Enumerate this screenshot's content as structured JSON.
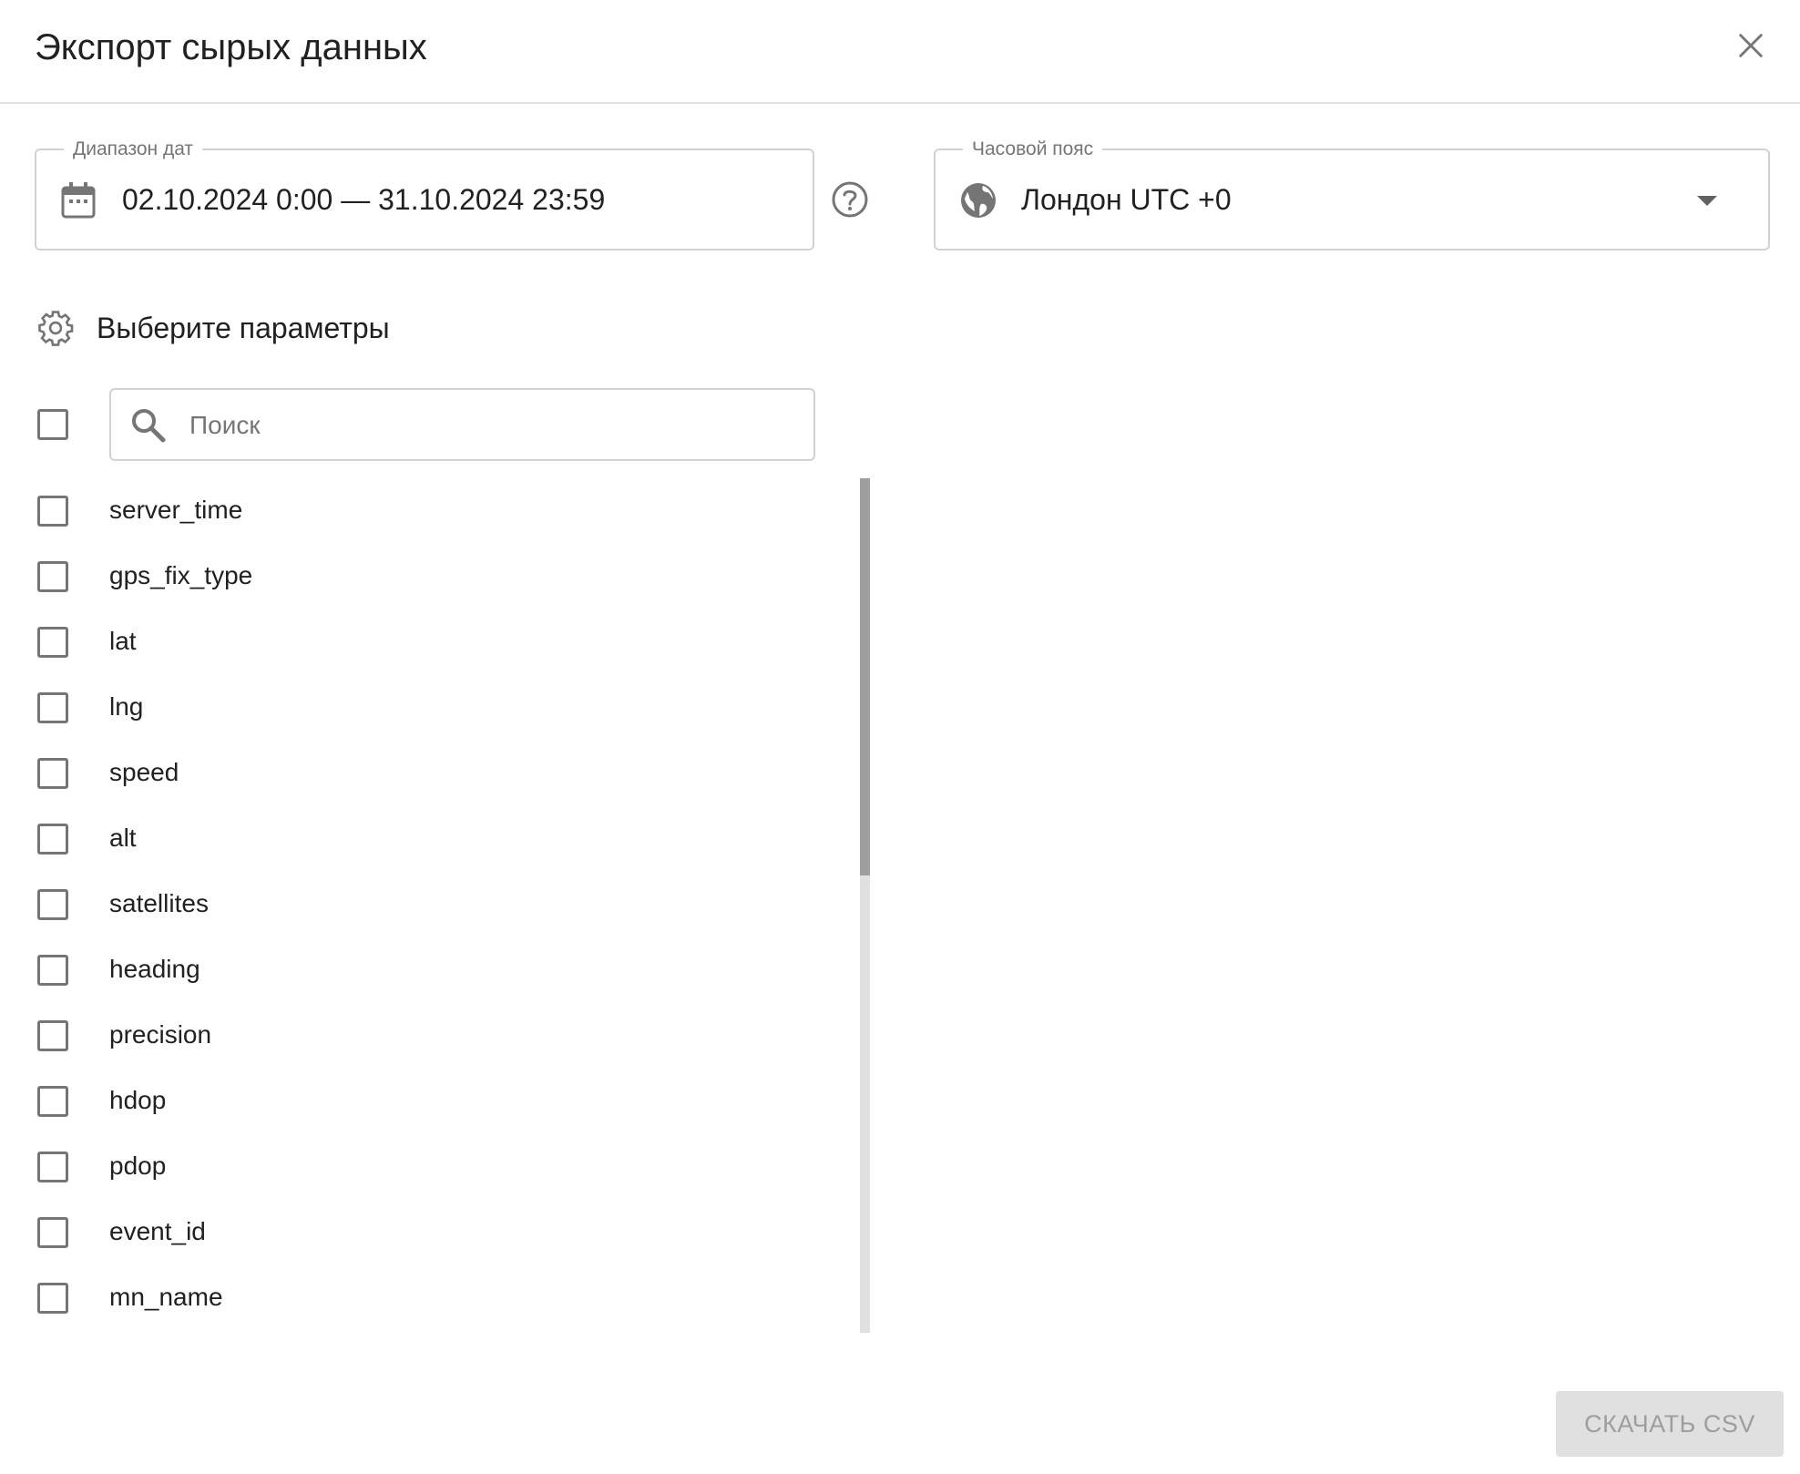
{
  "dialog": {
    "title": "Экспорт сырых данных",
    "close_icon": "close-icon"
  },
  "date_range": {
    "label": "Диапазон дат",
    "value": "02.10.2024 0:00 — 31.10.2024 23:59",
    "icon": "calendar-icon",
    "help_icon": "help-circle-icon"
  },
  "timezone": {
    "label": "Часовой пояс",
    "value": "Лондон UTC +0",
    "icon": "globe-icon",
    "dropdown_icon": "caret-down-icon"
  },
  "params": {
    "heading": "Выберите параметры",
    "icon": "gear-icon",
    "search_placeholder": "Поиск",
    "search_value": "",
    "select_all_checked": false,
    "items": [
      {
        "label": "server_time",
        "checked": false
      },
      {
        "label": "gps_fix_type",
        "checked": false
      },
      {
        "label": "lat",
        "checked": false
      },
      {
        "label": "lng",
        "checked": false
      },
      {
        "label": "speed",
        "checked": false
      },
      {
        "label": "alt",
        "checked": false
      },
      {
        "label": "satellites",
        "checked": false
      },
      {
        "label": "heading",
        "checked": false
      },
      {
        "label": "precision",
        "checked": false
      },
      {
        "label": "hdop",
        "checked": false
      },
      {
        "label": "pdop",
        "checked": false
      },
      {
        "label": "event_id",
        "checked": false
      },
      {
        "label": "mn_name",
        "checked": false
      }
    ]
  },
  "actions": {
    "download_label": "Скачать CSV",
    "download_enabled": false
  },
  "colors": {
    "text_primary": "#212121",
    "text_secondary": "#757575",
    "border": "#d2d2d2",
    "disabled_bg": "#e0e0e0",
    "disabled_text": "#9e9e9e"
  }
}
